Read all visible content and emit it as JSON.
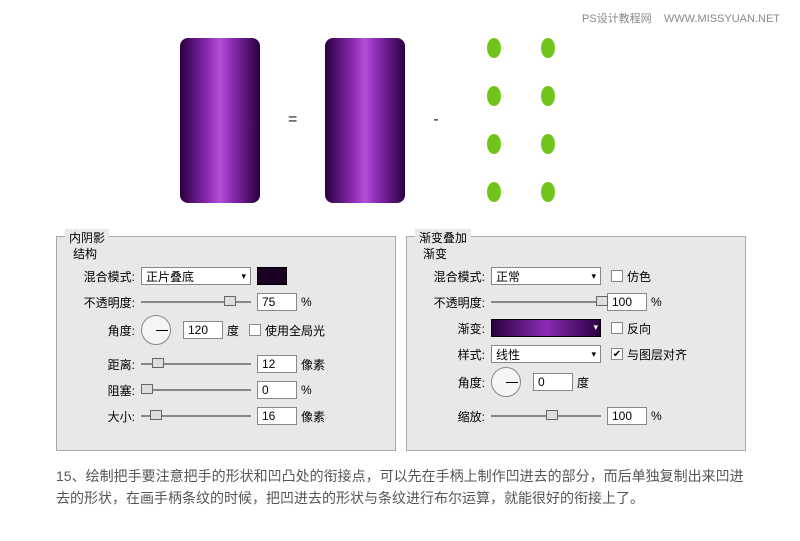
{
  "watermark": {
    "site_cn": "PS设计教程网",
    "site_url": "WWW.MISSYUAN.NET"
  },
  "illustration": {
    "equals": "=",
    "minus": "-"
  },
  "panels": {
    "inner_shadow": {
      "title": "内阴影",
      "structure": "结构",
      "blend_mode_label": "混合模式:",
      "blend_mode_value": "正片叠底",
      "swatch_color": "#1a0022",
      "opacity_label": "不透明度:",
      "opacity_value": "75",
      "opacity_unit": "%",
      "angle_label": "角度:",
      "angle_value": "120",
      "angle_unit": "度",
      "global_light_label": "使用全局光",
      "global_light_checked": false,
      "distance_label": "距离:",
      "distance_value": "12",
      "distance_unit": "像素",
      "choke_label": "阻塞:",
      "choke_value": "0",
      "choke_unit": "%",
      "size_label": "大小:",
      "size_value": "16",
      "size_unit": "像素"
    },
    "gradient_overlay": {
      "title": "渐变叠加",
      "sub": "渐变",
      "blend_mode_label": "混合模式:",
      "blend_mode_value": "正常",
      "dither_label": "仿色",
      "dither_checked": false,
      "opacity_label": "不透明度:",
      "opacity_value": "100",
      "opacity_unit": "%",
      "gradient_label": "渐变:",
      "reverse_label": "反向",
      "reverse_checked": false,
      "style_label": "样式:",
      "style_value": "线性",
      "align_label": "与图层对齐",
      "align_checked": true,
      "angle_label": "角度:",
      "angle_value": "0",
      "angle_unit": "度",
      "scale_label": "缩放:",
      "scale_value": "100",
      "scale_unit": "%"
    }
  },
  "step": {
    "text": "15、绘制把手要注意把手的形状和凹凸处的衔接点，可以先在手柄上制作凹进去的部分，而后单独复制出来凹进去的形状，在画手柄条纹的时候，把凹进去的形状与条纹进行布尔运算，就能很好的衔接上了。"
  }
}
